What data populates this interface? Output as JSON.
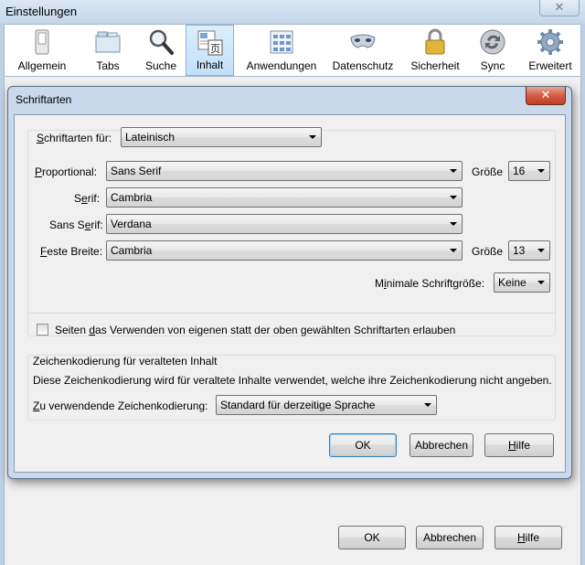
{
  "window": {
    "title": "Einstellungen",
    "close_glyph": "✕"
  },
  "toolbar": {
    "items": [
      {
        "label": "Allgemein",
        "icon": "switch-icon"
      },
      {
        "label": "Tabs",
        "icon": "tabs-icon"
      },
      {
        "label": "Suche",
        "icon": "magnifier-icon"
      },
      {
        "label": "Inhalt",
        "icon": "content-icon",
        "selected": true
      },
      {
        "label": "Anwendungen",
        "icon": "applications-icon"
      },
      {
        "label": "Datenschutz",
        "icon": "mask-icon"
      },
      {
        "label": "Sicherheit",
        "icon": "padlock-icon"
      },
      {
        "label": "Sync",
        "icon": "sync-icon"
      },
      {
        "label": "Erweitert",
        "icon": "gear-icon"
      }
    ]
  },
  "dialog": {
    "title": "Schriftarten",
    "close_glyph": "✕",
    "fonts_for": {
      "label_u": "S",
      "label_rest": "chriftarten für:",
      "value": "Lateinisch"
    },
    "proportional": {
      "label_u": "P",
      "label_rest": "roportional:",
      "value": "Sans Serif",
      "size_label": "Größe",
      "size_value": "16"
    },
    "serif": {
      "label_pre": "S",
      "label_u": "e",
      "label_rest": "rif:",
      "value": "Cambria"
    },
    "sans_serif": {
      "label_pre": "Sans S",
      "label_u": "e",
      "label_rest": "rif:",
      "value": "Verdana"
    },
    "fixed": {
      "label_u": "F",
      "label_rest": "este Breite:",
      "value": "Cambria",
      "size_label": "Größe",
      "size_value": "13"
    },
    "min_size": {
      "label_pre": "M",
      "label_u": "i",
      "label_rest": "nimale Schriftgröße:",
      "value": "Keine"
    },
    "allow_own_fonts": {
      "label_pre": "Seiten ",
      "label_u": "d",
      "label_rest": "as Verwenden von eigenen statt der oben gewählten Schriftarten erlauben",
      "checked": false
    },
    "encoding": {
      "heading": "Zeichenkodierung für veralteten Inhalt",
      "description": "Diese Zeichenkodierung wird für veraltete Inhalte verwendet, welche ihre Zeichenkodierung nicht angeben.",
      "label_u": "Z",
      "label_rest": "u verwendende Zeichenkodierung:",
      "value": "Standard für derzeitige Sprache"
    },
    "buttons": {
      "ok": "OK",
      "cancel": "Abbrechen",
      "help_u": "H",
      "help_rest": "ilfe"
    }
  },
  "footer_buttons": {
    "ok": "OK",
    "cancel": "Abbrechen",
    "help_u": "H",
    "help_rest": "ilfe"
  }
}
